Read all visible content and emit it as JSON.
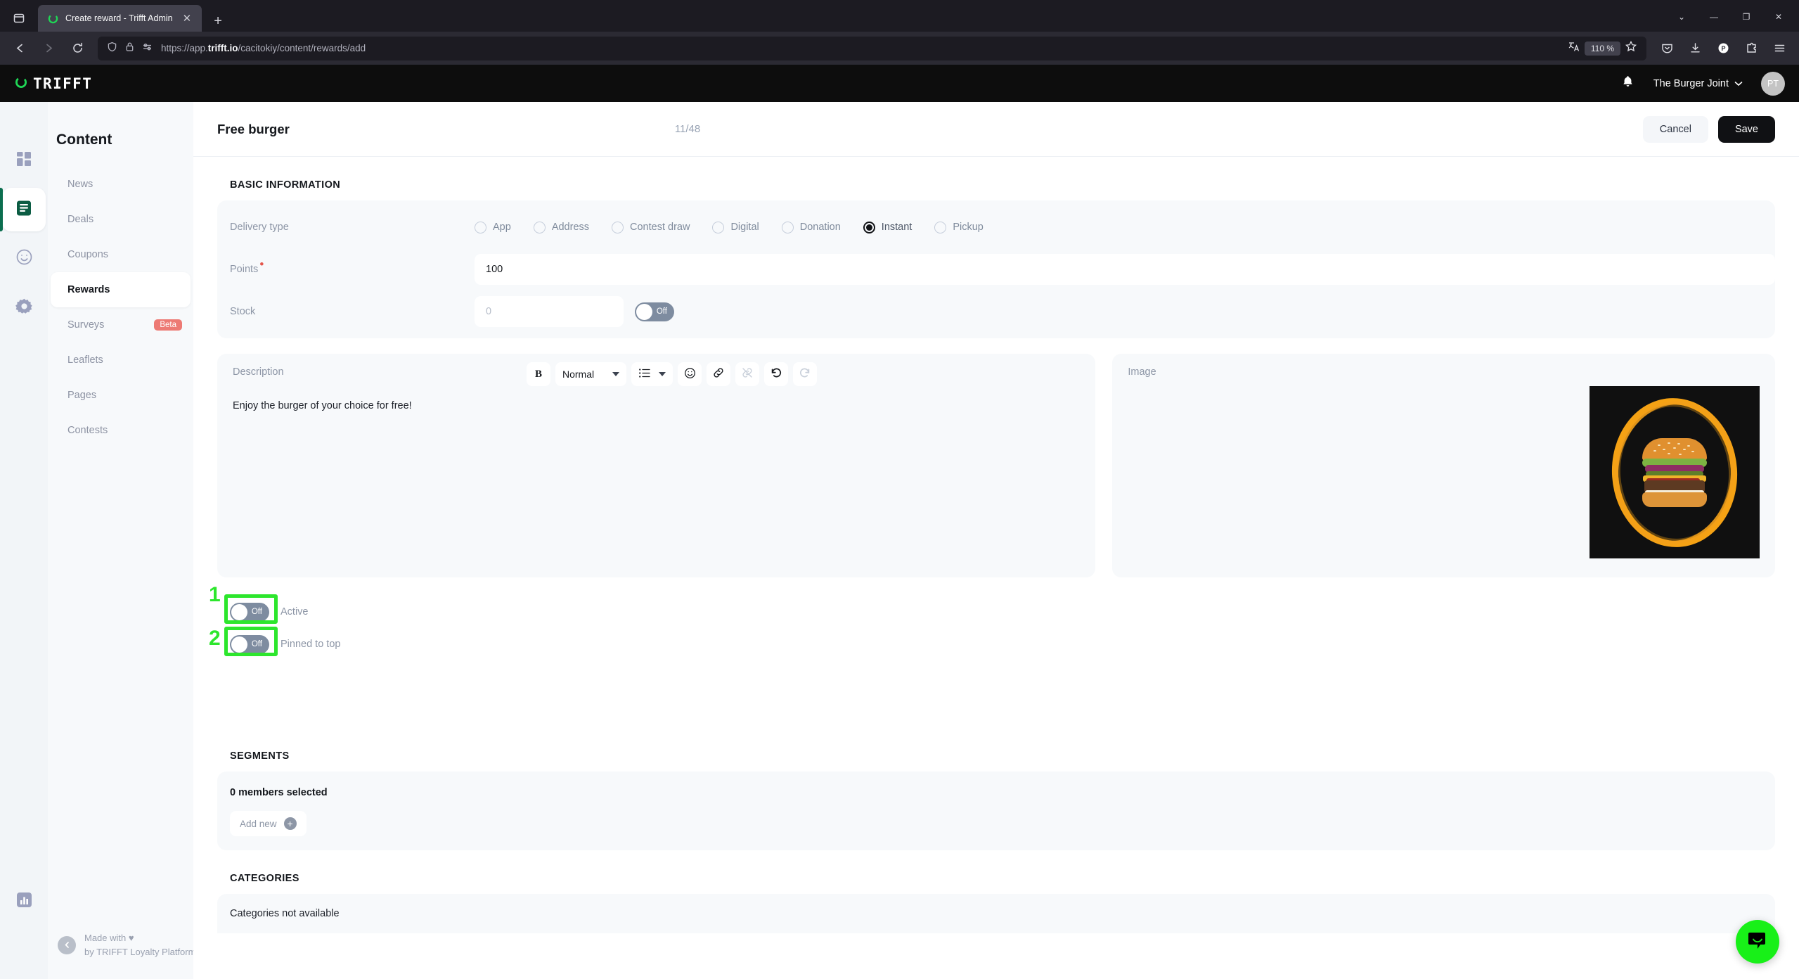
{
  "browser": {
    "tab": {
      "title": "Create reward - Trifft Admin",
      "favicon": "trifft-circle-icon",
      "close": "✕"
    },
    "newtab_label": "+",
    "window_controls": {
      "minimize": "—",
      "maximize": "❐",
      "close": "✕",
      "list_tabs": "⌄"
    },
    "url": {
      "scheme": "https://app.",
      "domain": "trifft.io",
      "path": "/cacitokiy/content/rewards/add"
    },
    "zoom_level": "110 %",
    "nav_icons": [
      "back-icon",
      "forward-icon",
      "reload-icon"
    ],
    "urlbar_icons": [
      "shield-icon",
      "lock-icon",
      "permissions-icon"
    ],
    "toolbar_icons": [
      "translate-icon",
      "bookmark-star-icon",
      "pocket-icon",
      "downloads-icon",
      "profile-icon",
      "extensions-icon",
      "app-menu-icon"
    ]
  },
  "app_header": {
    "logo_text": "TRIFFT",
    "logo_icon": "trifft-circle-icon",
    "notifications_icon": "bell-icon",
    "org_name": "The Burger Joint",
    "org_chevron": "⌄",
    "avatar_initials": "PT"
  },
  "rail": {
    "items": [
      {
        "name": "dashboard",
        "icon": "grid-icon",
        "active": false
      },
      {
        "name": "content",
        "icon": "document-icon",
        "active": true
      },
      {
        "name": "engagement",
        "icon": "smiley-icon",
        "active": false
      },
      {
        "name": "settings",
        "icon": "gear-icon",
        "active": false
      }
    ],
    "bottom_item": {
      "name": "analytics",
      "icon": "bar-chart-icon"
    }
  },
  "sidebar": {
    "title": "Content",
    "items": [
      {
        "label": "News",
        "active": false
      },
      {
        "label": "Deals",
        "active": false
      },
      {
        "label": "Coupons",
        "active": false
      },
      {
        "label": "Rewards",
        "active": true
      },
      {
        "label": "Surveys",
        "active": false,
        "badge": "Beta"
      },
      {
        "label": "Leaflets",
        "active": false
      },
      {
        "label": "Pages",
        "active": false
      },
      {
        "label": "Contests",
        "active": false
      }
    ],
    "footer": {
      "collapse_icon": "chevron-left-icon",
      "line1": "Made with ♥",
      "line2": "by TRIFFT Loyalty Platform"
    }
  },
  "page": {
    "title": "Free burger",
    "char_count": "11/48",
    "cancel_label": "Cancel",
    "save_label": "Save"
  },
  "basic_information": {
    "heading": "BASIC INFORMATION",
    "delivery_type": {
      "label": "Delivery type",
      "options": [
        {
          "label": "App",
          "selected": false
        },
        {
          "label": "Address",
          "selected": false
        },
        {
          "label": "Contest draw",
          "selected": false
        },
        {
          "label": "Digital",
          "selected": false
        },
        {
          "label": "Donation",
          "selected": false
        },
        {
          "label": "Instant",
          "selected": true
        },
        {
          "label": "Pickup",
          "selected": false
        }
      ]
    },
    "points": {
      "label": "Points",
      "required_marker": "•",
      "value": "100"
    },
    "stock": {
      "label": "Stock",
      "placeholder": "0",
      "value": "",
      "toggle_label": "Off",
      "toggle_state": "off"
    }
  },
  "description_panel": {
    "label": "Description",
    "text": "Enjoy the burger of your choice for free!",
    "toolbar": {
      "bold_label": "B",
      "style_value": "Normal",
      "list_icon": "bullet-list-icon",
      "emoji_icon": "emoji-icon",
      "link_icon": "link-icon",
      "unlink_icon": "unlink-icon",
      "undo_icon": "undo-icon",
      "redo_icon": "redo-icon"
    }
  },
  "image_panel": {
    "label": "Image",
    "alt": "burger-photo"
  },
  "status_toggles": [
    {
      "label": "Active",
      "toggle_label": "Off",
      "state": "off",
      "annotation": "1"
    },
    {
      "label": "Pinned to top",
      "toggle_label": "Off",
      "state": "off",
      "annotation": "2"
    }
  ],
  "segments": {
    "heading": "SEGMENTS",
    "members_text": "0 members selected",
    "add_new_label": "Add new",
    "add_new_icon": "plus-circle-icon"
  },
  "categories": {
    "heading": "CATEGORIES",
    "empty_text": "Categories not available"
  },
  "chat_widget": {
    "icon": "chat-bubble-icon"
  },
  "colors": {
    "brand_green": "#25d366",
    "accent_dark": "#101114",
    "annotation_green": "#2de62d",
    "required_red": "#e4574c",
    "beta_badge": "#ed7a74",
    "toggle_off": "#7e8ca0"
  }
}
